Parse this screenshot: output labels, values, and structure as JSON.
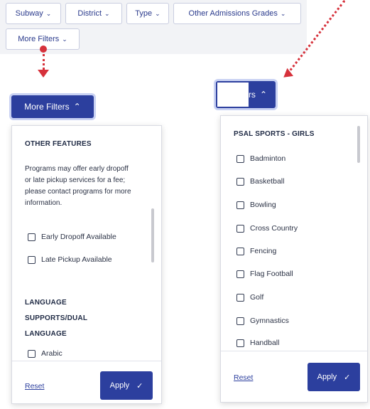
{
  "filter_bar": {
    "subway": "Subway",
    "district": "District",
    "type": "Type",
    "other_grades": "Other Admissions Grades",
    "more_filters": "More Filters"
  },
  "left_panel": {
    "button_label": "More Filters",
    "section1_title": "OTHER FEATURES",
    "description": "Programs may offer early dropoff or late pickup services for a fee; please contact programs for more information.",
    "options1": [
      "Early Dropoff Available",
      "Late Pickup Available"
    ],
    "section2_title": "LANGUAGE SUPPORTS/DUAL LANGUAGE",
    "options2": [
      "Arabic"
    ],
    "reset": "Reset",
    "apply": "Apply"
  },
  "right_panel": {
    "button_label_visible": "rs",
    "section_title": "PSAL SPORTS - GIRLS",
    "options": [
      "Badminton",
      "Basketball",
      "Bowling",
      "Cross Country",
      "Fencing",
      "Flag Football",
      "Golf",
      "Gymnastics",
      "Handball"
    ],
    "reset": "Reset",
    "apply": "Apply"
  },
  "icons": {
    "chevron_down": "⌄",
    "chevron_up": "⌃",
    "check": "✓"
  },
  "colors": {
    "brand_blue": "#2c3f9e",
    "annotation_red": "#d6313b"
  }
}
